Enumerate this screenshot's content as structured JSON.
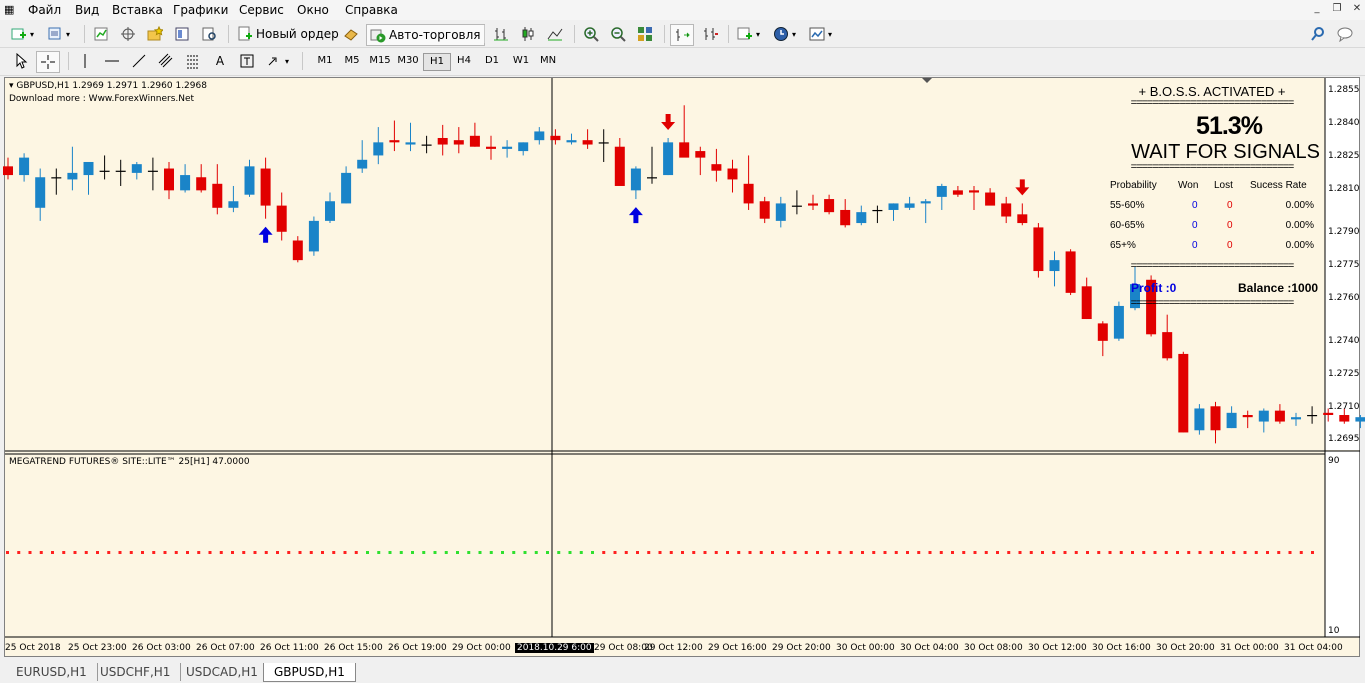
{
  "menu": [
    "Файл",
    "Вид",
    "Вставка",
    "Графики",
    "Сервис",
    "Окно",
    "Справка"
  ],
  "toolbar": {
    "new_order_label": "Новый ордер",
    "auto_trading_label": "Авто-торговля"
  },
  "timeframes": [
    "M1",
    "M5",
    "M15",
    "M30",
    "H1",
    "H4",
    "D1",
    "W1",
    "MN"
  ],
  "active_timeframe": "H1",
  "chart": {
    "header_info": "GBPUSD,H1  1.2969 1.2971 1.2960 1.2968",
    "download_text": "Download more : Www.ForexWinners.Net",
    "indicator_label": "MEGATREND FUTURES®    SITE::LITE™  25[H1] 47.0000",
    "indicator_scale_top": "90",
    "indicator_scale_bottom": "10",
    "cursor_time_label": "2018.10.29 6:00"
  },
  "panel": {
    "title": "+ B.O.S.S. ACTIVATED +",
    "divider": "==============================",
    "percent": "51.3%",
    "status": "WAIT FOR SIGNALS",
    "headers": [
      "Probability",
      "Won",
      "Lost",
      "Sucess Rate"
    ],
    "rows": [
      {
        "prob": "55-60%",
        "won": "0",
        "lost": "0",
        "rate": "0.00%"
      },
      {
        "prob": "60-65%",
        "won": "0",
        "lost": "0",
        "rate": "0.00%"
      },
      {
        "prob": "65+%",
        "won": "0",
        "lost": "0",
        "rate": "0.00%"
      }
    ],
    "profit": "Profit :0",
    "balance": "Balance :1000"
  },
  "colors": {
    "bull": "#1a84c8",
    "bear": "#e10000",
    "up_arrow": "#0000e0",
    "down_arrow": "#e00000",
    "chart_bg": "#fdf6e3",
    "dot_red": "#ff2020",
    "dot_green": "#30e030"
  },
  "tabs": [
    "EURUSD,H1",
    "USDCHF,H1",
    "USDCAD,H1",
    "GBPUSD,H1"
  ],
  "active_tab": "GBPUSD,H1",
  "chart_data": {
    "type": "candlestick",
    "symbol": "GBPUSD",
    "timeframe": "H1",
    "y_ticks": [
      "1.2855",
      "1.2840",
      "1.2825",
      "1.2810",
      "1.2790",
      "1.2775",
      "1.2760",
      "1.2740",
      "1.2725",
      "1.2710",
      "1.2695"
    ],
    "x_ticks": [
      "25 Oct 2018",
      "25 Oct 23:00",
      "26 Oct 03:00",
      "26 Oct 07:00",
      "26 Oct 11:00",
      "26 Oct 15:00",
      "26 Oct 19:00",
      "29 Oct 00:00",
      "2018.10.29 6:00",
      "29 Oct 08:00",
      "29 Oct 12:00",
      "29 Oct 16:00",
      "29 Oct 20:00",
      "30 Oct 00:00",
      "30 Oct 04:00",
      "30 Oct 08:00",
      "30 Oct 12:00",
      "30 Oct 16:00",
      "30 Oct 20:00",
      "31 Oct 00:00",
      "31 Oct 04:00"
    ],
    "candles": [
      {
        "o": 1.282,
        "h": 1.2824,
        "l": 1.2814,
        "c": 1.2816
      },
      {
        "o": 1.2816,
        "h": 1.2826,
        "l": 1.2813,
        "c": 1.2824
      },
      {
        "o": 1.2801,
        "h": 1.2819,
        "l": 1.2795,
        "c": 1.2815
      },
      {
        "o": 1.2815,
        "h": 1.2819,
        "l": 1.2807,
        "c": 1.2815
      },
      {
        "o": 1.2814,
        "h": 1.2829,
        "l": 1.2809,
        "c": 1.2817
      },
      {
        "o": 1.2816,
        "h": 1.2821,
        "l": 1.2807,
        "c": 1.2822
      },
      {
        "o": 1.2818,
        "h": 1.2825,
        "l": 1.2814,
        "c": 1.2818
      },
      {
        "o": 1.2818,
        "h": 1.2823,
        "l": 1.2811,
        "c": 1.2818
      },
      {
        "o": 1.2817,
        "h": 1.2822,
        "l": 1.2814,
        "c": 1.2821
      },
      {
        "o": 1.2818,
        "h": 1.2824,
        "l": 1.2809,
        "c": 1.2818
      },
      {
        "o": 1.2819,
        "h": 1.2822,
        "l": 1.2805,
        "c": 1.2809
      },
      {
        "o": 1.2809,
        "h": 1.2821,
        "l": 1.2808,
        "c": 1.2816
      },
      {
        "o": 1.2815,
        "h": 1.2821,
        "l": 1.2808,
        "c": 1.2809
      },
      {
        "o": 1.2812,
        "h": 1.2821,
        "l": 1.2798,
        "c": 1.2801
      },
      {
        "o": 1.2801,
        "h": 1.2811,
        "l": 1.2799,
        "c": 1.2804
      },
      {
        "o": 1.2807,
        "h": 1.2823,
        "l": 1.2806,
        "c": 1.282
      },
      {
        "o": 1.2819,
        "h": 1.2824,
        "l": 1.2796,
        "c": 1.2802
      },
      {
        "o": 1.2802,
        "h": 1.2808,
        "l": 1.2786,
        "c": 1.279
      },
      {
        "o": 1.2786,
        "h": 1.2788,
        "l": 1.2776,
        "c": 1.2777
      },
      {
        "o": 1.2781,
        "h": 1.2797,
        "l": 1.2779,
        "c": 1.2795
      },
      {
        "o": 1.2795,
        "h": 1.2808,
        "l": 1.2794,
        "c": 1.2804
      },
      {
        "o": 1.2803,
        "h": 1.282,
        "l": 1.2803,
        "c": 1.2817
      },
      {
        "o": 1.2819,
        "h": 1.2832,
        "l": 1.2817,
        "c": 1.2823
      },
      {
        "o": 1.2825,
        "h": 1.2838,
        "l": 1.2821,
        "c": 1.2831
      },
      {
        "o": 1.2832,
        "h": 1.2841,
        "l": 1.2827,
        "c": 1.2831
      },
      {
        "o": 1.283,
        "h": 1.284,
        "l": 1.2827,
        "c": 1.2831
      },
      {
        "o": 1.283,
        "h": 1.2834,
        "l": 1.2826,
        "c": 1.283
      },
      {
        "o": 1.2833,
        "h": 1.2839,
        "l": 1.2825,
        "c": 1.283
      },
      {
        "o": 1.2832,
        "h": 1.2838,
        "l": 1.2826,
        "c": 1.283
      },
      {
        "o": 1.2834,
        "h": 1.284,
        "l": 1.2829,
        "c": 1.2829
      },
      {
        "o": 1.2829,
        "h": 1.2834,
        "l": 1.2823,
        "c": 1.2828
      },
      {
        "o": 1.2828,
        "h": 1.2832,
        "l": 1.2824,
        "c": 1.2829
      },
      {
        "o": 1.2827,
        "h": 1.2831,
        "l": 1.2825,
        "c": 1.2831
      },
      {
        "o": 1.2832,
        "h": 1.2838,
        "l": 1.283,
        "c": 1.2836
      },
      {
        "o": 1.2834,
        "h": 1.2837,
        "l": 1.283,
        "c": 1.2832
      },
      {
        "o": 1.2831,
        "h": 1.2835,
        "l": 1.283,
        "c": 1.2832
      },
      {
        "o": 1.2832,
        "h": 1.2837,
        "l": 1.2828,
        "c": 1.283
      },
      {
        "o": 1.2831,
        "h": 1.2837,
        "l": 1.2822,
        "c": 1.2831
      },
      {
        "o": 1.2829,
        "h": 1.2833,
        "l": 1.2812,
        "c": 1.2811
      },
      {
        "o": 1.2809,
        "h": 1.282,
        "l": 1.2805,
        "c": 1.2819
      },
      {
        "o": 1.2815,
        "h": 1.2829,
        "l": 1.2812,
        "c": 1.2815
      },
      {
        "o": 1.2816,
        "h": 1.2833,
        "l": 1.2816,
        "c": 1.2831
      },
      {
        "o": 1.2831,
        "h": 1.2848,
        "l": 1.2826,
        "c": 1.2824
      },
      {
        "o": 1.2827,
        "h": 1.2829,
        "l": 1.2816,
        "c": 1.2824
      },
      {
        "o": 1.2821,
        "h": 1.2828,
        "l": 1.2813,
        "c": 1.2818
      },
      {
        "o": 1.2819,
        "h": 1.2823,
        "l": 1.2808,
        "c": 1.2814
      },
      {
        "o": 1.2812,
        "h": 1.2825,
        "l": 1.28,
        "c": 1.2803
      },
      {
        "o": 1.2804,
        "h": 1.2806,
        "l": 1.2794,
        "c": 1.2796
      },
      {
        "o": 1.2795,
        "h": 1.2806,
        "l": 1.2792,
        "c": 1.2803
      },
      {
        "o": 1.2802,
        "h": 1.2809,
        "l": 1.2798,
        "c": 1.2802
      },
      {
        "o": 1.2803,
        "h": 1.2807,
        "l": 1.28,
        "c": 1.2802
      },
      {
        "o": 1.2805,
        "h": 1.2807,
        "l": 1.2798,
        "c": 1.2799
      },
      {
        "o": 1.28,
        "h": 1.2805,
        "l": 1.2792,
        "c": 1.2793
      },
      {
        "o": 1.2794,
        "h": 1.2802,
        "l": 1.2793,
        "c": 1.2799
      },
      {
        "o": 1.28,
        "h": 1.2802,
        "l": 1.2794,
        "c": 1.28
      },
      {
        "o": 1.28,
        "h": 1.2803,
        "l": 1.2795,
        "c": 1.2803
      },
      {
        "o": 1.2801,
        "h": 1.2806,
        "l": 1.28,
        "c": 1.2803
      },
      {
        "o": 1.2803,
        "h": 1.2805,
        "l": 1.2794,
        "c": 1.2804
      },
      {
        "o": 1.2806,
        "h": 1.2812,
        "l": 1.28,
        "c": 1.2811
      },
      {
        "o": 1.2809,
        "h": 1.2811,
        "l": 1.2806,
        "c": 1.2807
      },
      {
        "o": 1.2809,
        "h": 1.2811,
        "l": 1.28,
        "c": 1.2808
      },
      {
        "o": 1.2808,
        "h": 1.281,
        "l": 1.2805,
        "c": 1.2802
      },
      {
        "o": 1.2803,
        "h": 1.2806,
        "l": 1.2794,
        "c": 1.2797
      },
      {
        "o": 1.2798,
        "h": 1.2803,
        "l": 1.2793,
        "c": 1.2794
      },
      {
        "o": 1.2792,
        "h": 1.2794,
        "l": 1.2769,
        "c": 1.2772
      },
      {
        "o": 1.2772,
        "h": 1.2781,
        "l": 1.2765,
        "c": 1.2777
      },
      {
        "o": 1.2781,
        "h": 1.2782,
        "l": 1.2761,
        "c": 1.2762
      },
      {
        "o": 1.2765,
        "h": 1.2769,
        "l": 1.275,
        "c": 1.275
      },
      {
        "o": 1.2748,
        "h": 1.2749,
        "l": 1.2733,
        "c": 1.274
      },
      {
        "o": 1.2741,
        "h": 1.2758,
        "l": 1.274,
        "c": 1.2756
      },
      {
        "o": 1.2755,
        "h": 1.2774,
        "l": 1.2754,
        "c": 1.2766
      },
      {
        "o": 1.2768,
        "h": 1.277,
        "l": 1.2742,
        "c": 1.2743
      },
      {
        "o": 1.2744,
        "h": 1.2752,
        "l": 1.2731,
        "c": 1.2732
      },
      {
        "o": 1.2734,
        "h": 1.2735,
        "l": 1.2698,
        "c": 1.2698
      },
      {
        "o": 1.2699,
        "h": 1.2711,
        "l": 1.2697,
        "c": 1.2709
      },
      {
        "o": 1.271,
        "h": 1.2712,
        "l": 1.2693,
        "c": 1.2699
      },
      {
        "o": 1.27,
        "h": 1.271,
        "l": 1.27,
        "c": 1.2707
      },
      {
        "o": 1.2706,
        "h": 1.2708,
        "l": 1.27,
        "c": 1.2705
      },
      {
        "o": 1.2703,
        "h": 1.2709,
        "l": 1.2698,
        "c": 1.2708
      },
      {
        "o": 1.2708,
        "h": 1.2711,
        "l": 1.2702,
        "c": 1.2703
      },
      {
        "o": 1.2704,
        "h": 1.2707,
        "l": 1.2701,
        "c": 1.2705
      },
      {
        "o": 1.2706,
        "h": 1.271,
        "l": 1.2702,
        "c": 1.2706
      },
      {
        "o": 1.2707,
        "h": 1.2709,
        "l": 1.2703,
        "c": 1.2706
      },
      {
        "o": 1.2706,
        "h": 1.2709,
        "l": 1.2702,
        "c": 1.2703
      },
      {
        "o": 1.2703,
        "h": 1.2706,
        "l": 1.27,
        "c": 1.2705
      },
      {
        "o": 1.2704,
        "h": 1.2709,
        "l": 1.2701,
        "c": 1.2708
      },
      {
        "o": 1.2707,
        "h": 1.2714,
        "l": 1.2703,
        "c": 1.2711
      }
    ],
    "signals": [
      {
        "index": 16,
        "dir": "up"
      },
      {
        "index": 39,
        "dir": "up"
      },
      {
        "index": 41,
        "dir": "down"
      },
      {
        "index": 63,
        "dir": "down"
      }
    ]
  }
}
